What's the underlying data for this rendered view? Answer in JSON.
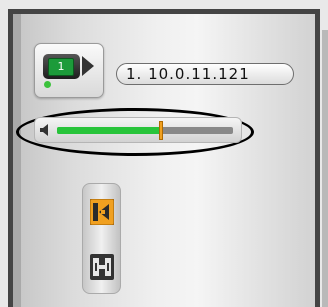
{
  "camera": {
    "channel_label": "1",
    "icon": "camera-icon",
    "status_color": "#3cc23c"
  },
  "address": {
    "value": "1. 10.0.11.121"
  },
  "volume": {
    "icon": "speaker-icon",
    "level": 0.59,
    "fill_color": "#28c43a",
    "thumb_color": "#f0a020"
  },
  "side_controls": [
    {
      "icon": "talk-active-icon",
      "accent": "#f0a020"
    },
    {
      "icon": "talk-inactive-icon",
      "accent": "#333333"
    }
  ]
}
